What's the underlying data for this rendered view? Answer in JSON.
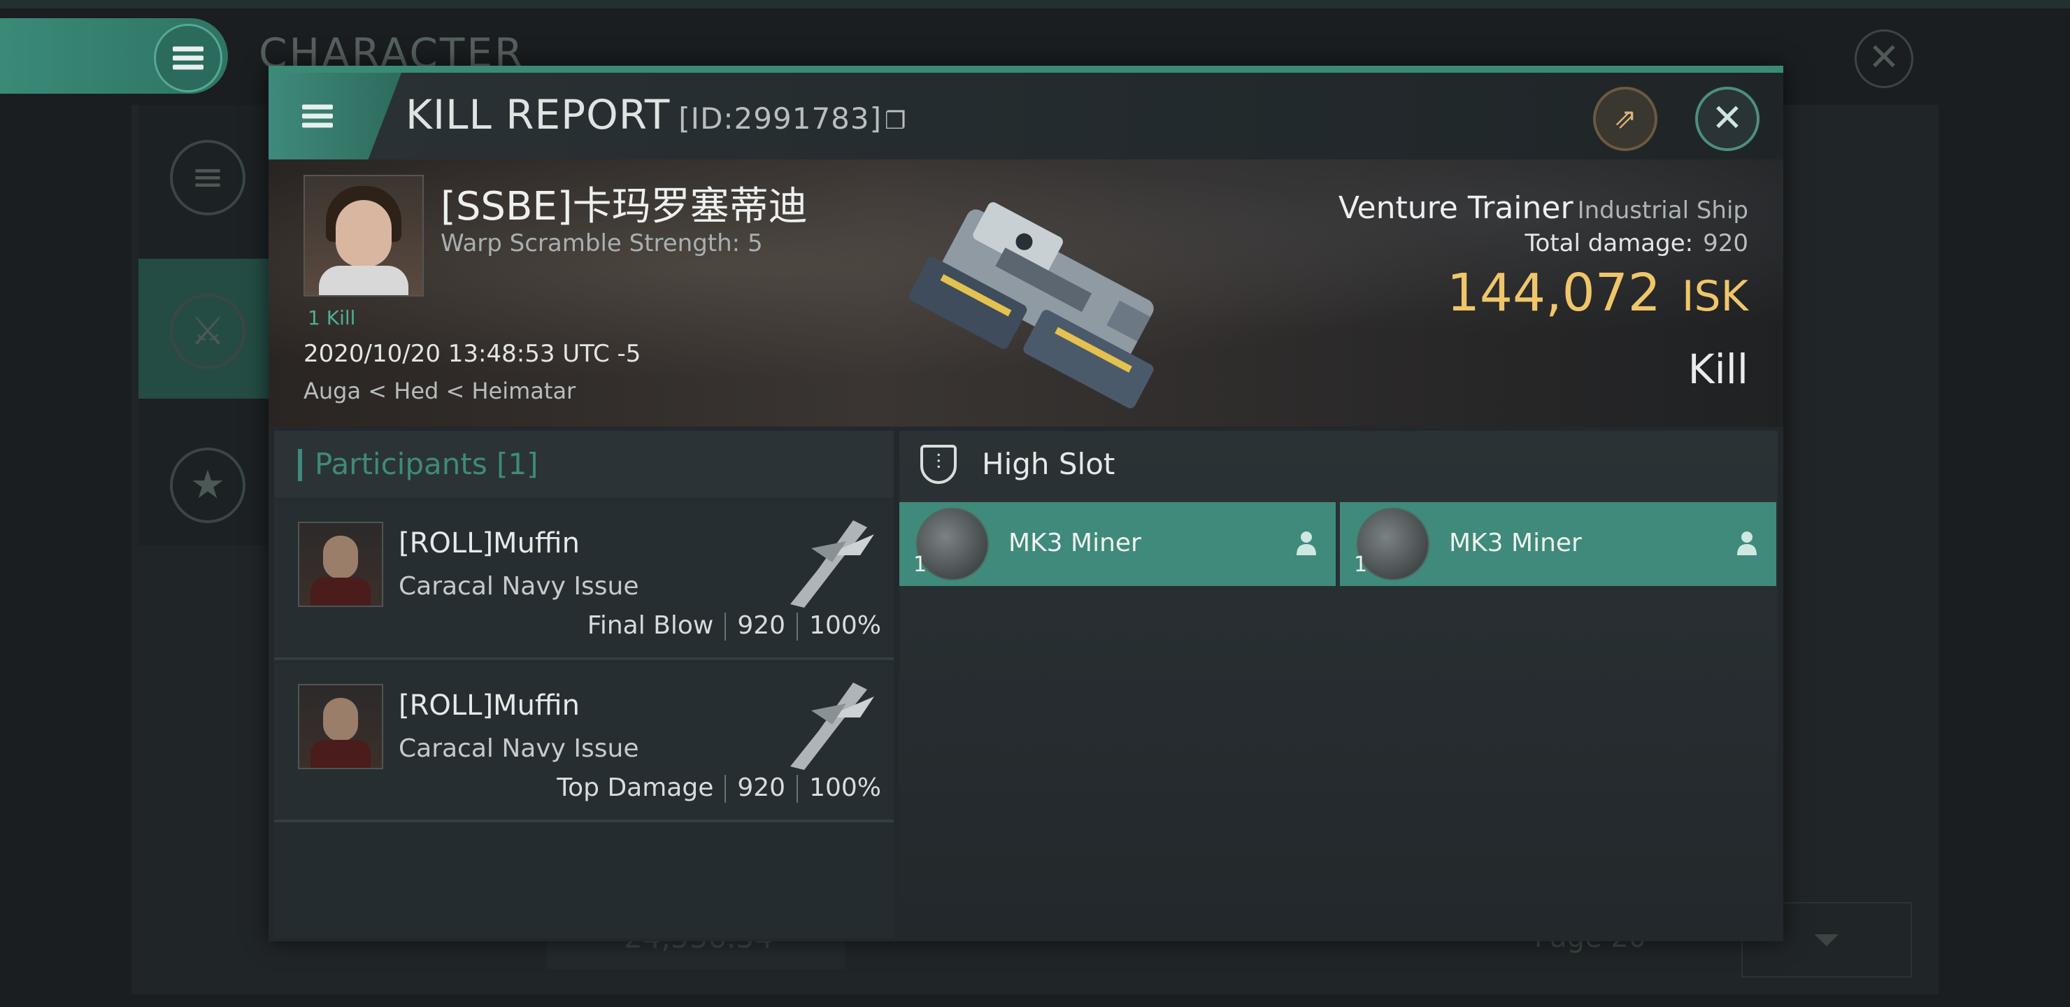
{
  "background": {
    "title": "CHARACTER",
    "bottom_value": "24,536.54",
    "page_label": "Page 20"
  },
  "window": {
    "title": "KILL REPORT",
    "report_id": "[ID:2991783]"
  },
  "victim": {
    "name": "[SSBE]卡玛罗塞蒂迪",
    "warp_scramble": "Warp Scramble Strength: 5",
    "kill_count": "1 Kill",
    "datetime": "2020/10/20 13:48:53 UTC -5",
    "location": "Auga < Hed < Heimatar"
  },
  "ship": {
    "name": "Venture Trainer",
    "class": "Industrial Ship",
    "total_damage_label": "Total damage:",
    "total_damage": "920",
    "isk_value": "144,072",
    "isk_unit": "ISK",
    "result": "Kill"
  },
  "participants": {
    "header": "Participants [1]",
    "rows": [
      {
        "name": "[ROLL]Muffin",
        "ship": "Caracal Navy Issue",
        "role": "Final Blow",
        "damage": "920",
        "percent": "100%"
      },
      {
        "name": "[ROLL]Muffin",
        "ship": "Caracal Navy Issue",
        "role": "Top Damage",
        "damage": "920",
        "percent": "100%"
      }
    ]
  },
  "fitting": {
    "section": "High Slot",
    "modules": [
      {
        "name": "MK3 Miner",
        "qty": "1"
      },
      {
        "name": "MK3 Miner",
        "qty": "1"
      }
    ]
  },
  "colors": {
    "accent": "#3f8a7a",
    "isk": "#f0c66a"
  }
}
